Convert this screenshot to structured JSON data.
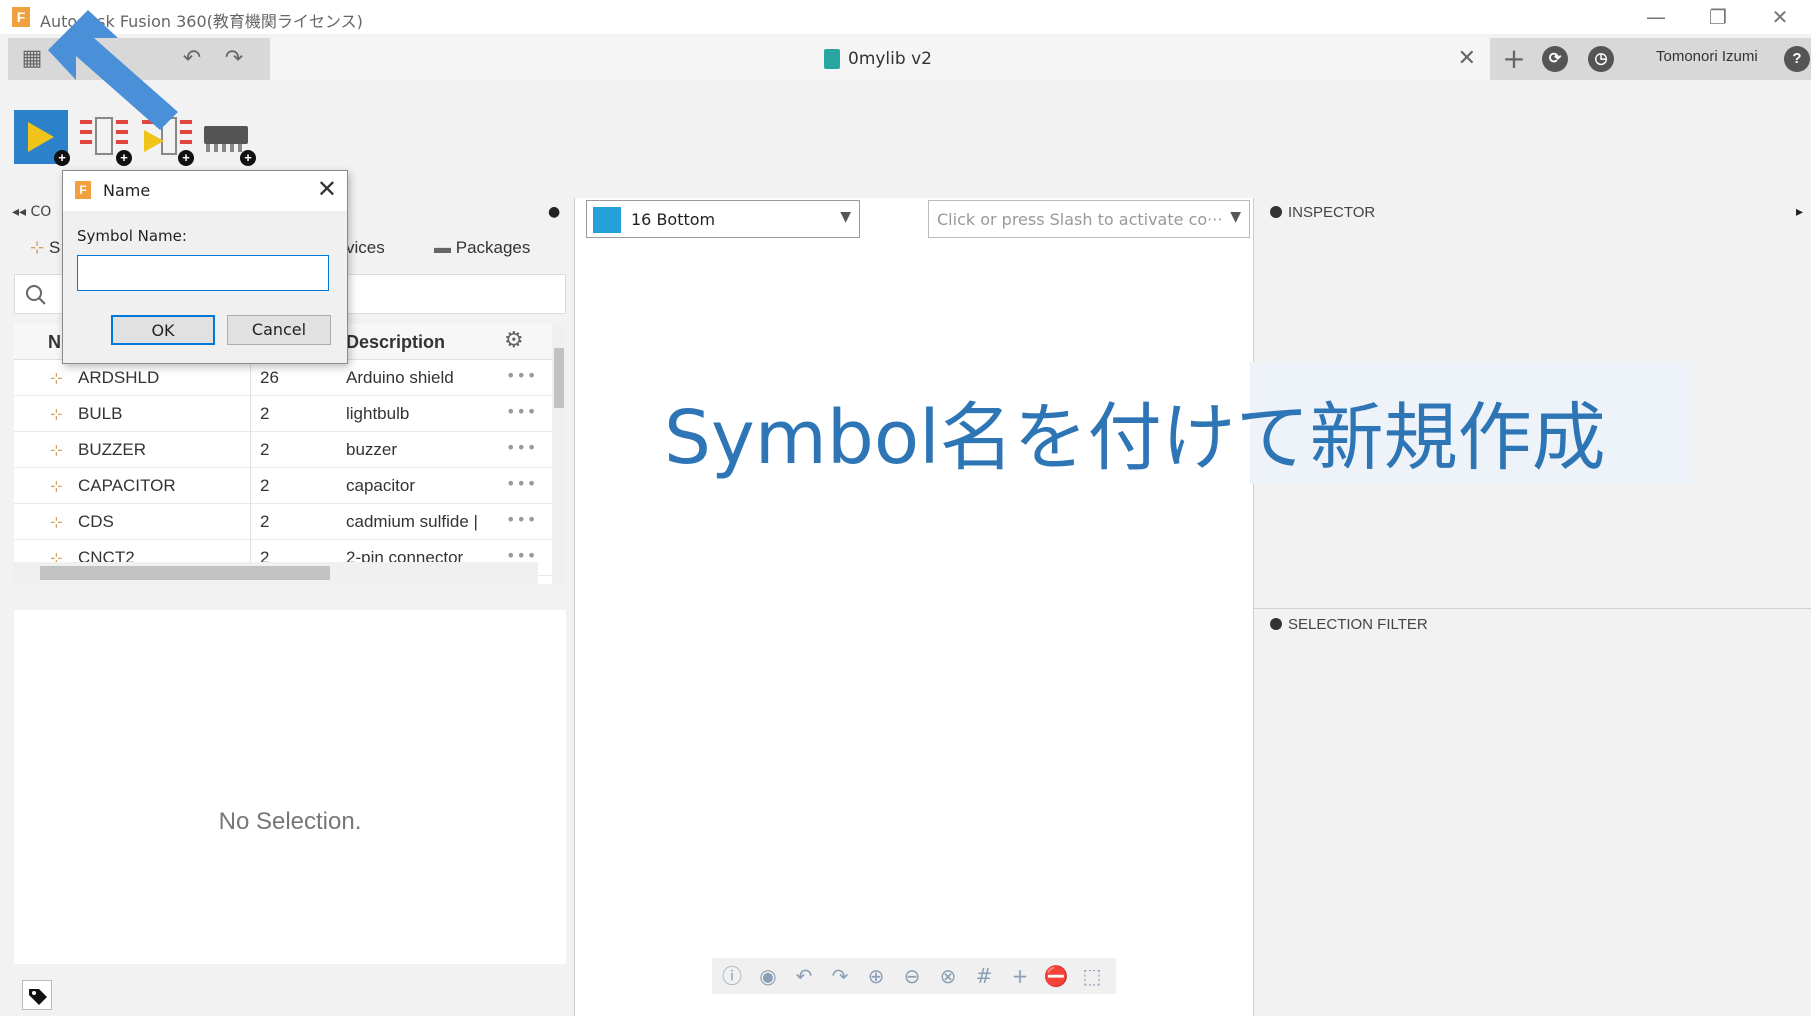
{
  "window": {
    "title": "Autodesk Fusion 360(教育機関ライセンス)",
    "minimize": "—",
    "restore": "❐",
    "close": "✕"
  },
  "appbar": {
    "grid_icon": "▦",
    "undo": "↶",
    "redo": "↷",
    "doc_tab_label": "0mylib v2",
    "doc_tab_close": "✕",
    "new_tab": "+",
    "user_name": "Tomonori Izumi",
    "help": "?"
  },
  "left_panel": {
    "header_partial": "CO",
    "tabs": [
      "S",
      "vices",
      "Packages"
    ],
    "columns": {
      "name": "N",
      "description": "Description"
    },
    "rows": [
      {
        "name": "ARDSHLD",
        "count": "26",
        "description": "Arduino shield",
        "more": "•••"
      },
      {
        "name": "BULB",
        "count": "2",
        "description": "lightbulb",
        "more": "•••"
      },
      {
        "name": "BUZZER",
        "count": "2",
        "description": "buzzer",
        "more": "•••"
      },
      {
        "name": "CAPACITOR",
        "count": "2",
        "description": "capacitor",
        "more": "•••"
      },
      {
        "name": "CDS",
        "count": "2",
        "description": "cadmium sulfide |",
        "more": "•••"
      },
      {
        "name": "CNCT2",
        "count": "2",
        "description": "2-pin connector",
        "more": "•••"
      }
    ],
    "no_selection": "No Selection."
  },
  "canvas": {
    "layer": "16 Bottom",
    "command_placeholder": "Click or press Slash to activate co···"
  },
  "inspector": {
    "title": "INSPECTOR"
  },
  "selection_filter": {
    "title": "SELECTION FILTER"
  },
  "annotation": "Symbol名を付けて新規作成",
  "dialog": {
    "title": "Name",
    "label": "Symbol Name:",
    "value": "",
    "ok": "OK",
    "cancel": "Cancel",
    "close": "✕"
  },
  "colors": {
    "accent": "#2e75b6",
    "arrow": "#4a90d9",
    "layer_swatch": "#24a0d8",
    "brand_orange": "#f0a03c"
  }
}
